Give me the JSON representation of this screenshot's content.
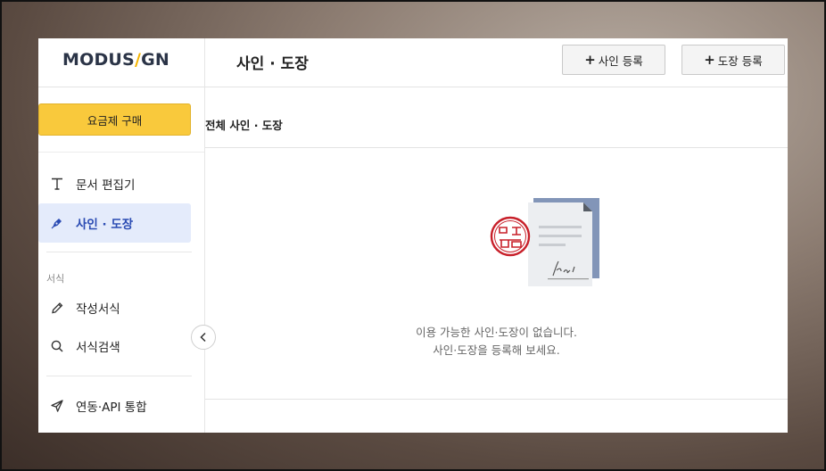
{
  "logo": {
    "text_before": "MODUS",
    "slash": "/",
    "text_after": "GN"
  },
  "header": {
    "title": "사인 · 도장",
    "buttons": [
      {
        "plus": "+",
        "label": "사인 등록"
      },
      {
        "plus": "+",
        "label": "도장 등록"
      }
    ]
  },
  "sidebar": {
    "buy_button": "요금제 구매",
    "items": [
      {
        "label": "문서 편집기",
        "icon": "text-t-icon"
      },
      {
        "label": "사인 · 도장",
        "icon": "pen-nib-icon",
        "active": true
      }
    ],
    "section_label": "서식",
    "section_items": [
      {
        "label": "작성서식",
        "icon": "pencil-icon"
      },
      {
        "label": "서식검색",
        "icon": "magnifier-icon"
      }
    ],
    "bottom_items": [
      {
        "label": "연동·API 통합",
        "icon": "send-arrow-icon"
      }
    ],
    "collapse_icon": "chevron-left-icon"
  },
  "main": {
    "subtitle": "전체 사인 · 도장",
    "empty_line1": "이용 가능한 사인·도장이 없습니다.",
    "empty_line2": "사인·도장을 등록해 보세요.",
    "illustration": "document-stamp-signature-icon"
  },
  "colors": {
    "accent_yellow": "#f9c93c",
    "active_bg": "#e4ebfb",
    "active_text": "#2a4bb3",
    "logo_slash": "#f5b400",
    "stamp_red": "#c8202a"
  }
}
